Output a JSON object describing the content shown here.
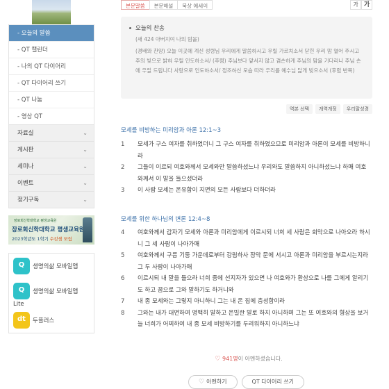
{
  "sidebar": {
    "submenu": [
      {
        "label": "- 오늘의 말씀",
        "active": true
      },
      {
        "label": "- QT 캘린더"
      },
      {
        "label": "- 나의 QT 다이어리"
      },
      {
        "label": "- QT 다이어리 쓰기"
      },
      {
        "label": "- QT 나눔"
      },
      {
        "label": "- 영상 QT"
      }
    ],
    "menu": [
      {
        "label": "자료실"
      },
      {
        "label": "게시판"
      },
      {
        "label": "세미나"
      },
      {
        "label": "이벤트"
      },
      {
        "label": "정기구독"
      }
    ],
    "banner": {
      "top": "장로회신학대학교 평생교육원",
      "main": "장로회신학대학교 평생교육원",
      "sub_prefix": "2023학년도 1학기",
      "sub_highlight": "수강생 모집"
    },
    "apps": [
      {
        "label": "생명의삶 모바일앱",
        "icon": "app-icon-teal"
      },
      {
        "label": "생명의삶 모바일앱",
        "label2": "Lite",
        "icon": "app-icon-teal"
      },
      {
        "label": "두플러스",
        "icon": "app-icon-yellow",
        "glyph": "dt"
      }
    ]
  },
  "tabs": [
    "본문말씀",
    "본문해설",
    "묵상 에세이"
  ],
  "font_buttons": {
    "small": "가",
    "large": "가"
  },
  "hymn": {
    "title": "오늘의 찬송",
    "subtitle": "(새 424 아버지여 나의 맘을)",
    "body": "(경배와 찬양) 오늘 이곳에 계신 성령님 우리에게 말씀하시고 우릴 가르치소서 닫힌 우리 맘 열어 주시고 주의 빛으로 밝혀 우릴 인도하소서/ (후렴) 주님보다 앞서지 않고 겸손하게 주님의 맘을 기다리니 주님 손에 우릴 드립니다 사랑으로 인도하소서/ 정조하신 모습 따라 우리를 예수님 닮게 빚으소서 (후렴 반복)"
  },
  "versions": [
    "역본 선택",
    "개역개정",
    "우리말성경"
  ],
  "sections": [
    {
      "title": "모세를 비방하는 미리암과 아론 12:1~3",
      "verses": [
        {
          "num": "1",
          "text": "모세가 구스 여자를 취하였더니 그 구스 여자를 취하였으므로 미리암과 아론이 모세를 비방하니라"
        },
        {
          "num": "2",
          "text": "그들이 이르되 여호와께서 모세와만 말씀하셨느냐 우리와도 말씀하지 아니하셨느냐 하매 여호와께서 이 말을 들으셨더라"
        },
        {
          "num": "3",
          "text": "이 사람 모세는 온유함이 지면의 모든 사람보다 더하더라"
        }
      ]
    },
    {
      "title": "모세를 위한 하나님의 변론 12:4~8",
      "verses": [
        {
          "num": "4",
          "text": "여호와께서 갑자기 모세와 아론과 미리암에게 이르시되 너희 세 사람은 회막으로 나아오라 하시니 그 세 사람이 나아가매"
        },
        {
          "num": "5",
          "text": "여호와께서 구름 기둥 가운데로부터 강림하사 장막 문에 서시고 아론과 미리암을 부르시는지라 그 두 사람이 나아가매"
        },
        {
          "num": "6",
          "text": "이르시되 내 말을 들으라 너희 중에 선지자가 있으면 나 여호와가 환상으로 나를 그에게 알리기도 하고 꿈으로 그와 말하기도 하거니와"
        },
        {
          "num": "7",
          "text": "내 종 모세와는 그렇지 아니하니 그는 내 온 집에 충성함이라"
        },
        {
          "num": "8",
          "text": "그와는 내가 대면하여 명백히 말하고 은밀한 말로 하지 아니하며 그는 또 여호와의 형상을 보거늘 너희가 어찌하여 내 종 모세 비방하기를 두려워하지 아니하느냐"
        }
      ]
    }
  ],
  "amen": {
    "count": "941명",
    "suffix": "이 아멘하셨습니다."
  },
  "buttons": {
    "amen": "아멘하기",
    "diary": "QT 다이어리 쓰기"
  },
  "colors": {
    "accent": "#5b8fbe",
    "section_title": "#3a6fa8",
    "heart": "#d9534f"
  }
}
